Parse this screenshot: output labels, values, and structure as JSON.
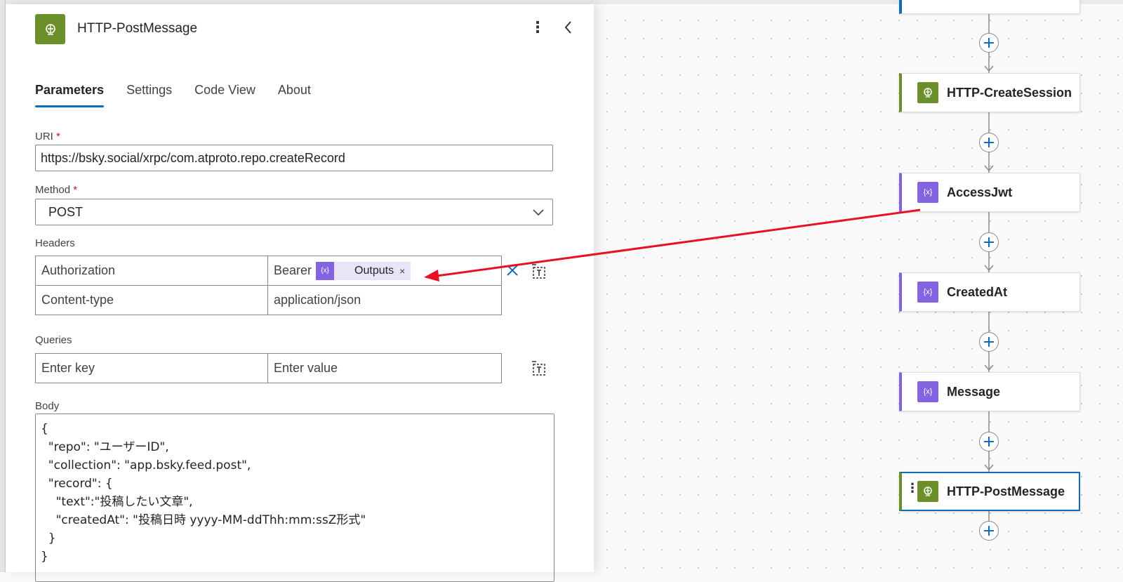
{
  "panel": {
    "title": "HTTP-PostMessage",
    "more_icon": "⋮",
    "tabs": [
      {
        "label": "Parameters",
        "active": true
      },
      {
        "label": "Settings"
      },
      {
        "label": "Code View"
      },
      {
        "label": "About"
      }
    ]
  },
  "params": {
    "uri_label": "URI",
    "uri_required": "*",
    "uri_value": "https://bsky.social/xrpc/com.atproto.repo.createRecord",
    "method_label": "Method",
    "method_required": "*",
    "method_value": "POST",
    "headers_label": "Headers",
    "headers": [
      {
        "key": "Authorization",
        "value": "Bearer",
        "token": "Outputs",
        "token_remove": "×"
      },
      {
        "key": "Content-type",
        "value": "application/json"
      }
    ],
    "queries_label": "Queries",
    "queries_key_placeholder": "Enter key",
    "queries_value_placeholder": "Enter value",
    "body_label": "Body",
    "body_value": "{\n  \"repo\": \"ユーザーID\",\n  \"collection\": \"app.bsky.feed.post\",\n  \"record\": {\n    \"text\":\"投稿したい文章\",\n    \"createdAt\": \"投稿日時 yyyy-MM-ddThh:mm:ssZ形式\"\n  }\n}"
  },
  "flow": {
    "nodes": [
      {
        "label": "HTTP-CreateSession",
        "kind": "http",
        "icon": "globe-icon"
      },
      {
        "label": "AccessJwt",
        "kind": "variable",
        "icon": "variable-icon"
      },
      {
        "label": "CreatedAt",
        "kind": "variable",
        "icon": "variable-icon"
      },
      {
        "label": "Message",
        "kind": "variable",
        "icon": "variable-icon"
      },
      {
        "label": "HTTP-PostMessage",
        "kind": "http",
        "icon": "globe-icon",
        "selected": true
      }
    ]
  },
  "colors": {
    "accent": "#0f6cbd",
    "http_green": "#6b8f2a",
    "variable_purple": "#8463e0",
    "annotation_arrow": "#e81123"
  }
}
